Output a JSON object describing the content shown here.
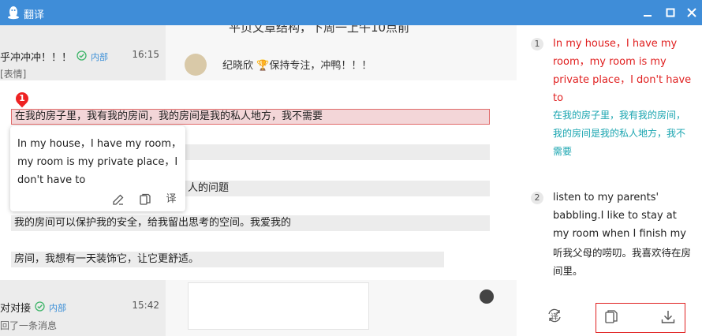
{
  "window": {
    "title": "翻译",
    "accent": "#3f8dd8"
  },
  "background": {
    "chat_items": [
      {
        "name": "乎冲冲冲！！！",
        "tag": "内部",
        "time": "16:15",
        "msg": "[表情]"
      },
      {
        "name": "对对接",
        "tag": "内部",
        "time": "15:42",
        "msg": "回了一条消息"
      }
    ],
    "top_text": "平页文章结构，下周一上午10点前",
    "chat_snippet": "纪晓欣  🏆保持专注，冲鸭！！！"
  },
  "source_paragraphs": [
    {
      "text": "在我的房子里，我有我的房间，我的房间是我的私人地方，我不需要",
      "active": true
    },
    {
      "text": "",
      "active": false
    },
    {
      "text": "人的问题",
      "active": false
    },
    {
      "text": "我的房间可以保护我的安全，给我留出思考的空间。我爱我的",
      "active": false
    },
    {
      "text": "房间，我想有一天装饰它，让它更舒适。",
      "active": false
    }
  ],
  "marker_number": "1",
  "tooltip": {
    "text": "In my house，I have my room，my room is my private place，I don't have to",
    "actions": [
      "edit-icon",
      "copy-icon",
      "translate-icon"
    ],
    "translate_label": "译"
  },
  "results": [
    {
      "index": "1",
      "en": "In my house，I have my room，my room is my private place，I don't have to",
      "zh": "在我的房子里，我有我的房间，我的房间是我的私人地方，我不需要",
      "en_color": "#e02020",
      "zh_color": "#1aa5b0"
    },
    {
      "index": "2",
      "en": "listen to my parents' babbling.I like to stay at my room when I finish my",
      "zh": "听我父母的唠叨。我喜欢待在房间里。",
      "en_color": "#222222",
      "zh_color": "#222222"
    }
  ],
  "bottom_actions": [
    "retranslate-icon",
    "copy-icon",
    "download-icon"
  ],
  "retranslate_label": "译"
}
